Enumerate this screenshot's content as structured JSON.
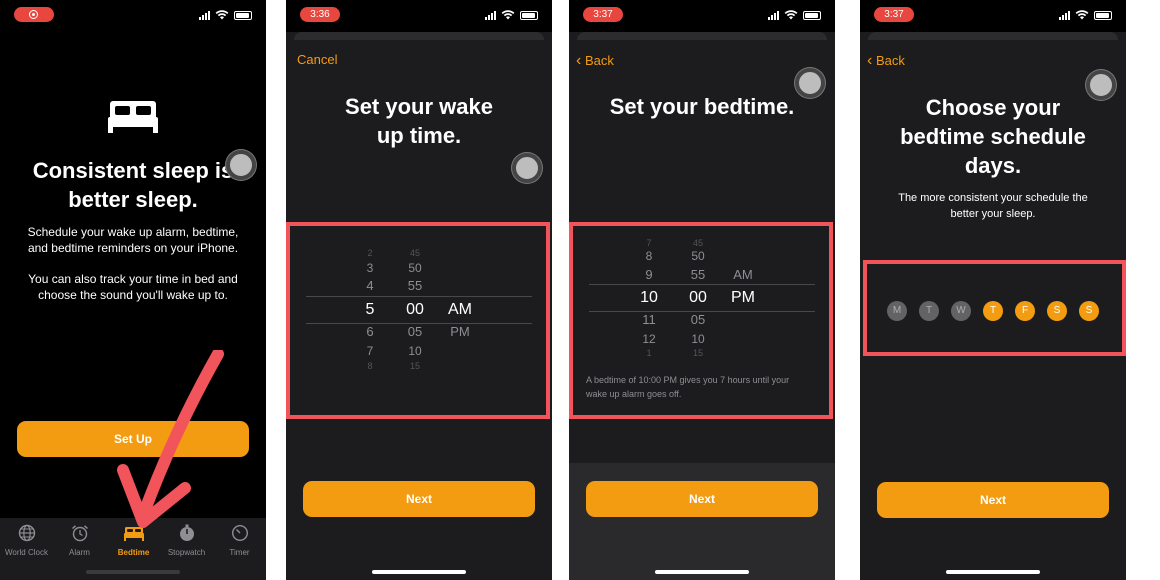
{
  "screen1": {
    "headline_line1": "Consistent sleep is",
    "headline_line2": "better sleep.",
    "para1_line1": "Schedule your wake up alarm, bedtime,",
    "para1_line2": "and bedtime reminders on your iPhone.",
    "para2_line1": "You can also track your time in bed and",
    "para2_line2": "choose the sound you'll wake up to.",
    "setup_button": "Set Up",
    "tabs": [
      {
        "label": "World Clock",
        "icon": "globe-icon"
      },
      {
        "label": "Alarm",
        "icon": "alarm-clock-icon"
      },
      {
        "label": "Bedtime",
        "icon": "bed-icon",
        "active": true
      },
      {
        "label": "Stopwatch",
        "icon": "stopwatch-icon"
      },
      {
        "label": "Timer",
        "icon": "timer-icon"
      }
    ]
  },
  "screen2": {
    "time": "3:36",
    "cancel": "Cancel",
    "title_line1": "Set your wake",
    "title_line2": "up time.",
    "picker": {
      "hours": [
        "2",
        "3",
        "4",
        "5",
        "6",
        "7",
        "8"
      ],
      "minutes": [
        "45",
        "50",
        "55",
        "00",
        "05",
        "10",
        "15"
      ],
      "ampm": [
        "AM",
        "PM"
      ],
      "selected": {
        "hour": "5",
        "minute": "00",
        "period": "AM"
      }
    },
    "next": "Next"
  },
  "screen3": {
    "time": "3:37",
    "back": "Back",
    "title": "Set your bedtime.",
    "picker": {
      "hours": [
        "7",
        "8",
        "9",
        "10",
        "11",
        "12",
        "1"
      ],
      "minutes": [
        "45",
        "50",
        "55",
        "00",
        "05",
        "10",
        "15"
      ],
      "ampm": [
        "AM",
        "PM"
      ],
      "selected": {
        "hour": "10",
        "minute": "00",
        "period": "PM"
      }
    },
    "footnote_line1": "A bedtime of 10:00 PM gives you 7 hours until your",
    "footnote_line2": "wake up alarm goes off.",
    "next": "Next"
  },
  "screen4": {
    "time": "3:37",
    "back": "Back",
    "title_line1": "Choose your",
    "title_line2": "bedtime schedule",
    "title_line3": "days.",
    "subtitle_line1": "The more consistent your schedule the",
    "subtitle_line2": "better your sleep.",
    "days": [
      {
        "letter": "M",
        "selected": false
      },
      {
        "letter": "T",
        "selected": false
      },
      {
        "letter": "W",
        "selected": false
      },
      {
        "letter": "T",
        "selected": true
      },
      {
        "letter": "F",
        "selected": true
      },
      {
        "letter": "S",
        "selected": true
      },
      {
        "letter": "S",
        "selected": true
      }
    ],
    "next": "Next"
  },
  "colors": {
    "accent": "#f39c12",
    "highlight": "#f2545b",
    "status_pill": "#e8473f"
  }
}
